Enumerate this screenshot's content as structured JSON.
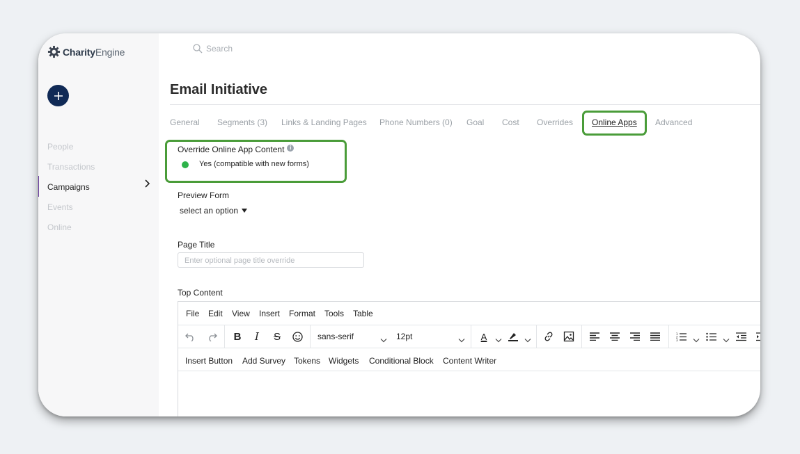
{
  "app": {
    "logo_bold": "Charity",
    "logo_light": "Engine"
  },
  "search": {
    "placeholder": "Search"
  },
  "sidebar": {
    "items": [
      {
        "label": "People"
      },
      {
        "label": "Transactions"
      },
      {
        "label": "Campaigns"
      },
      {
        "label": "Events"
      },
      {
        "label": "Online"
      }
    ]
  },
  "page": {
    "title": "Email Initiative"
  },
  "tabs": [
    {
      "label": "General"
    },
    {
      "label": "Segments (3)"
    },
    {
      "label": "Links & Landing Pages"
    },
    {
      "label": "Phone Numbers (0)"
    },
    {
      "label": "Goal"
    },
    {
      "label": "Cost"
    },
    {
      "label": "Overrides"
    },
    {
      "label": "Online Apps"
    },
    {
      "label": "Advanced"
    }
  ],
  "override": {
    "label": "Override Online App Content",
    "value": "Yes  (compatible with new forms)"
  },
  "preview": {
    "label": "Preview Form",
    "select": "select an option"
  },
  "page_title_field": {
    "label": "Page Title",
    "placeholder": "Enter optional page title override"
  },
  "top_content": {
    "label": "Top Content"
  },
  "editor": {
    "menus": [
      "File",
      "Edit",
      "View",
      "Insert",
      "Format",
      "Tools",
      "Table"
    ],
    "font_family": "sans-serif",
    "font_size": "12pt",
    "custom_menus": [
      "Insert Button",
      "Add Survey",
      "Tokens",
      "Widgets",
      "Conditional Block",
      "Content Writer"
    ]
  },
  "colors": {
    "accent_highlight": "#4a9c39",
    "nav_active_bar": "#6c3fa0",
    "add_button": "#102a56",
    "status_on": "#2eb34a"
  }
}
